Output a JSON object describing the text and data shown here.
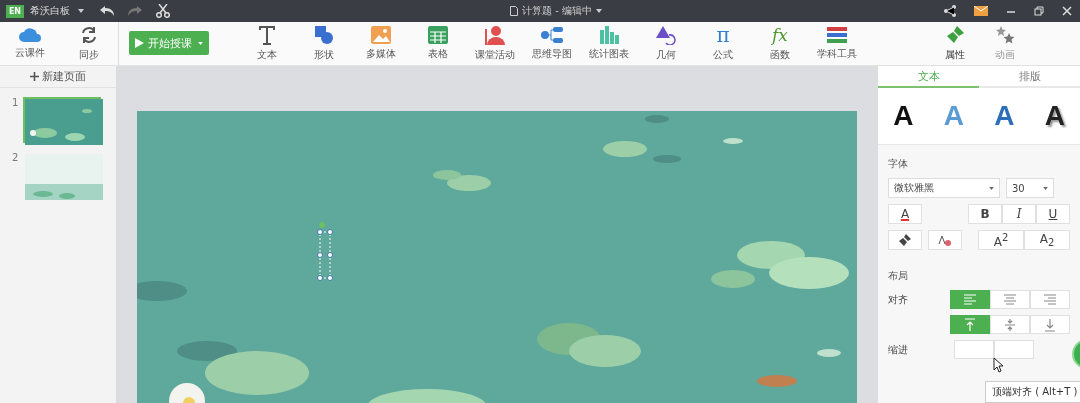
{
  "title_bar": {
    "logo": "EN",
    "app_name": "希沃白板",
    "document_title": "计算题 - 编辑中"
  },
  "toolbar": {
    "left": [
      {
        "kind": "cloud",
        "label": "云课件"
      },
      {
        "kind": "sync",
        "label": "同步"
      }
    ],
    "start_button": "开始授课",
    "tools": [
      {
        "kind": "text",
        "label": "文本"
      },
      {
        "kind": "shape",
        "label": "形状"
      },
      {
        "kind": "media",
        "label": "多媒体"
      },
      {
        "kind": "table",
        "label": "表格"
      },
      {
        "kind": "activity",
        "label": "课堂活动"
      },
      {
        "kind": "mindmap",
        "label": "思维导图"
      },
      {
        "kind": "chart",
        "label": "统计图表"
      },
      {
        "kind": "geometry",
        "label": "几何"
      },
      {
        "kind": "pi",
        "label": "公式",
        "glyph": "π"
      },
      {
        "kind": "fx",
        "label": "函数",
        "glyph": "fx"
      },
      {
        "kind": "books",
        "label": "学科工具"
      }
    ],
    "panel_tabs": [
      {
        "kind": "brush",
        "label": "属性",
        "selected": true
      },
      {
        "kind": "stars",
        "label": "动画",
        "selected": false
      }
    ]
  },
  "pages": {
    "new_page": "新建页面",
    "items": [
      {
        "number": "1",
        "kind": "pond",
        "selected": true
      },
      {
        "number": "2",
        "kind": "mist",
        "selected": false
      }
    ]
  },
  "panel": {
    "tabs": [
      {
        "label": "文本",
        "selected": true
      },
      {
        "label": "排版",
        "selected": false
      }
    ],
    "styles": [
      {
        "glyph": "A",
        "kind": "plain"
      },
      {
        "glyph": "A",
        "kind": "light-blue"
      },
      {
        "glyph": "A",
        "kind": "blue"
      },
      {
        "glyph": "A",
        "kind": "shadow"
      }
    ],
    "font_section": "字体",
    "font": "微软雅黑",
    "size": "30",
    "font_color": "A",
    "format_buttons": [
      {
        "label": "B",
        "kind": "bold"
      },
      {
        "label": "I",
        "kind": "italic"
      },
      {
        "label": "U",
        "kind": "underline"
      }
    ],
    "script_buttons": [
      "A$^{2}$",
      "A$_{2}$"
    ],
    "layout_section": "布局",
    "align_label": "对齐",
    "horizontal_align": [
      {
        "kind": "left",
        "selected": true
      },
      {
        "kind": "center",
        "selected": false
      },
      {
        "kind": "right",
        "selected": false
      }
    ],
    "vertical_align": [
      {
        "kind": "top",
        "selected": true
      },
      {
        "kind": "middle",
        "selected": false
      },
      {
        "kind": "bottom",
        "selected": false
      }
    ],
    "indent_label": "缩进",
    "tooltip": "顶端对齐 ( Alt+T )"
  }
}
